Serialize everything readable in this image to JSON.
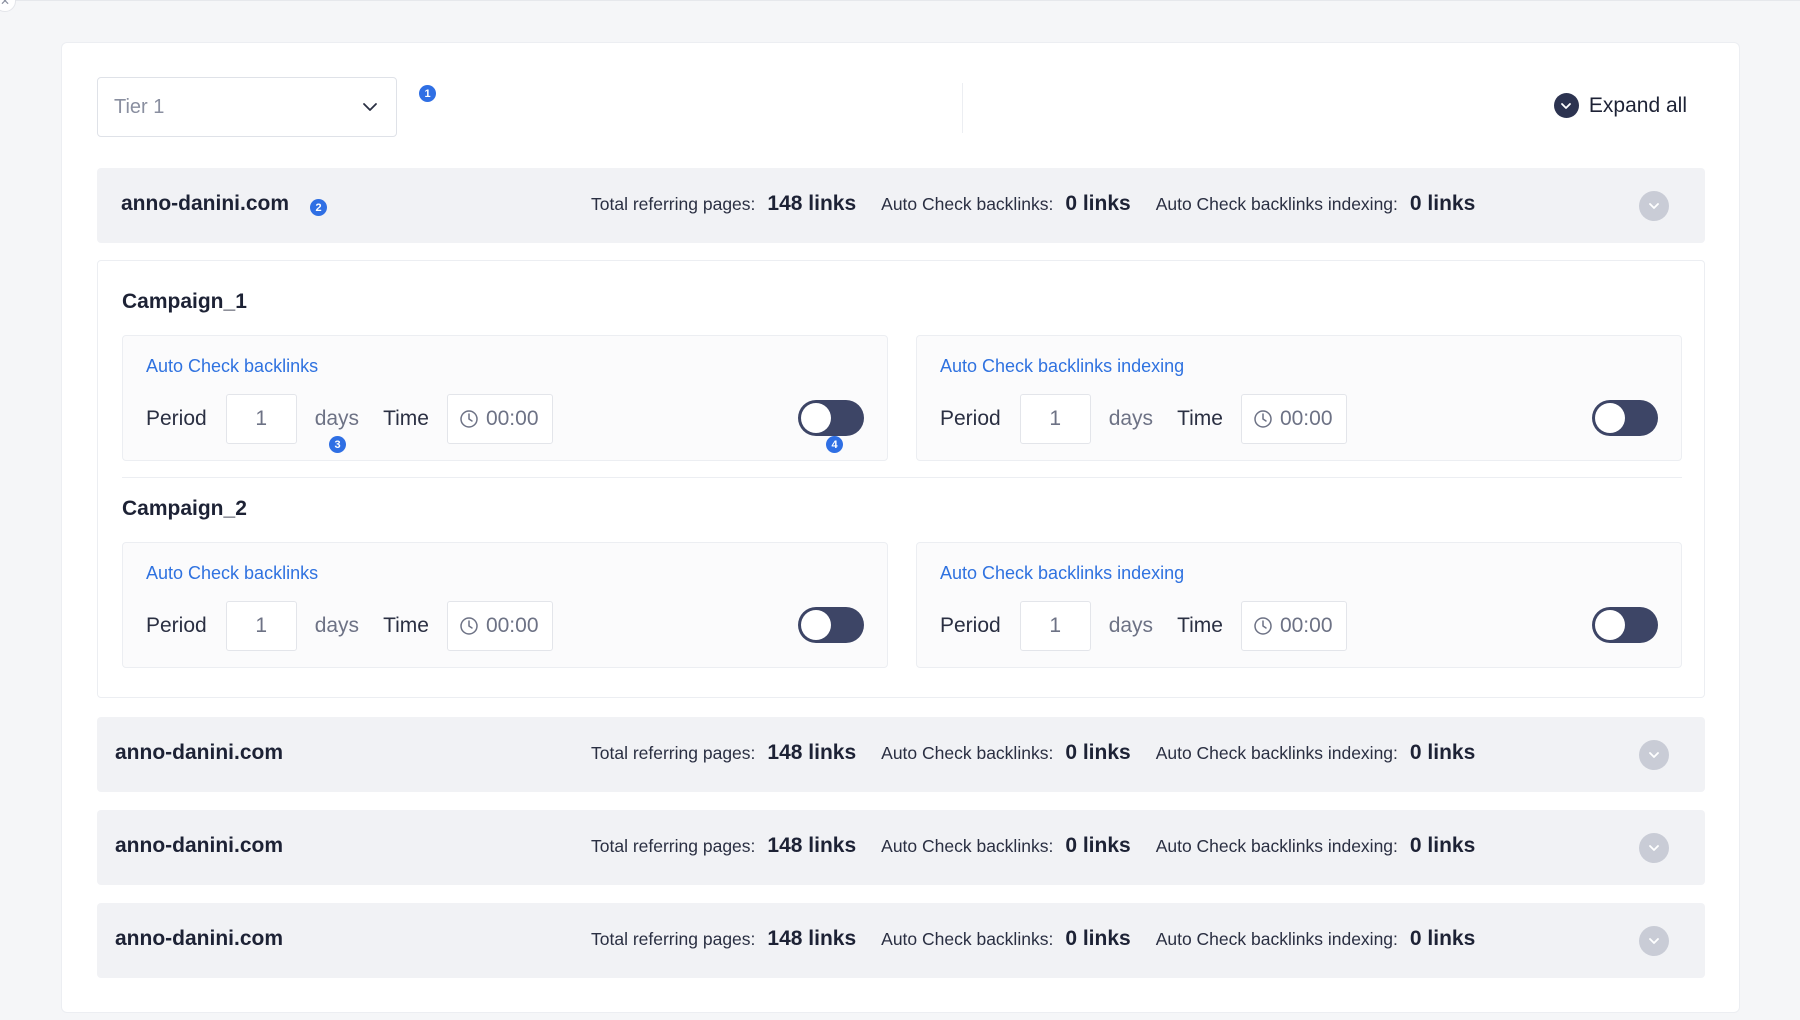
{
  "toolbar": {
    "tier_select_value": "Tier 1",
    "expand_all_label": "Expand all",
    "badge_1": "1"
  },
  "stats_labels": {
    "total_referring_pages": "Total referring pages:",
    "auto_check_backlinks": "Auto Check backlinks:",
    "auto_check_backlinks_indexing": "Auto Check backlinks indexing:"
  },
  "domains": [
    {
      "name": "anno-danini.com",
      "badge": "2",
      "total_referring_pages": "148 links",
      "auto_check_backlinks": "0 links",
      "auto_check_backlinks_indexing": "0 links",
      "expanded": true
    },
    {
      "name": "anno-danini.com",
      "total_referring_pages": "148 links",
      "auto_check_backlinks": "0 links",
      "auto_check_backlinks_indexing": "0 links",
      "expanded": false
    },
    {
      "name": "anno-danini.com",
      "total_referring_pages": "148 links",
      "auto_check_backlinks": "0 links",
      "auto_check_backlinks_indexing": "0 links",
      "expanded": false
    },
    {
      "name": "anno-danini.com",
      "total_referring_pages": "148 links",
      "auto_check_backlinks": "0 links",
      "auto_check_backlinks_indexing": "0 links",
      "expanded": false
    }
  ],
  "field_labels": {
    "period": "Period",
    "days": "days",
    "time": "Time"
  },
  "campaigns": [
    {
      "name": "Campaign_1",
      "backlinks": {
        "title": "Auto Check backlinks",
        "period": "1",
        "time": "00:00",
        "enabled": false,
        "badge_days": "3",
        "badge_toggle": "4"
      },
      "indexing": {
        "title": "Auto Check backlinks indexing",
        "period": "1",
        "time": "00:00",
        "enabled": false
      }
    },
    {
      "name": "Campaign_2",
      "backlinks": {
        "title": "Auto Check backlinks",
        "period": "1",
        "time": "00:00",
        "enabled": false
      },
      "indexing": {
        "title": "Auto Check backlinks indexing",
        "period": "1",
        "time": "00:00",
        "enabled": false
      }
    }
  ],
  "colors": {
    "accent": "#2f72e0",
    "badge": "#2f6fe4",
    "toggle_off": "#3d4566",
    "row_bg": "#f1f2f5"
  }
}
